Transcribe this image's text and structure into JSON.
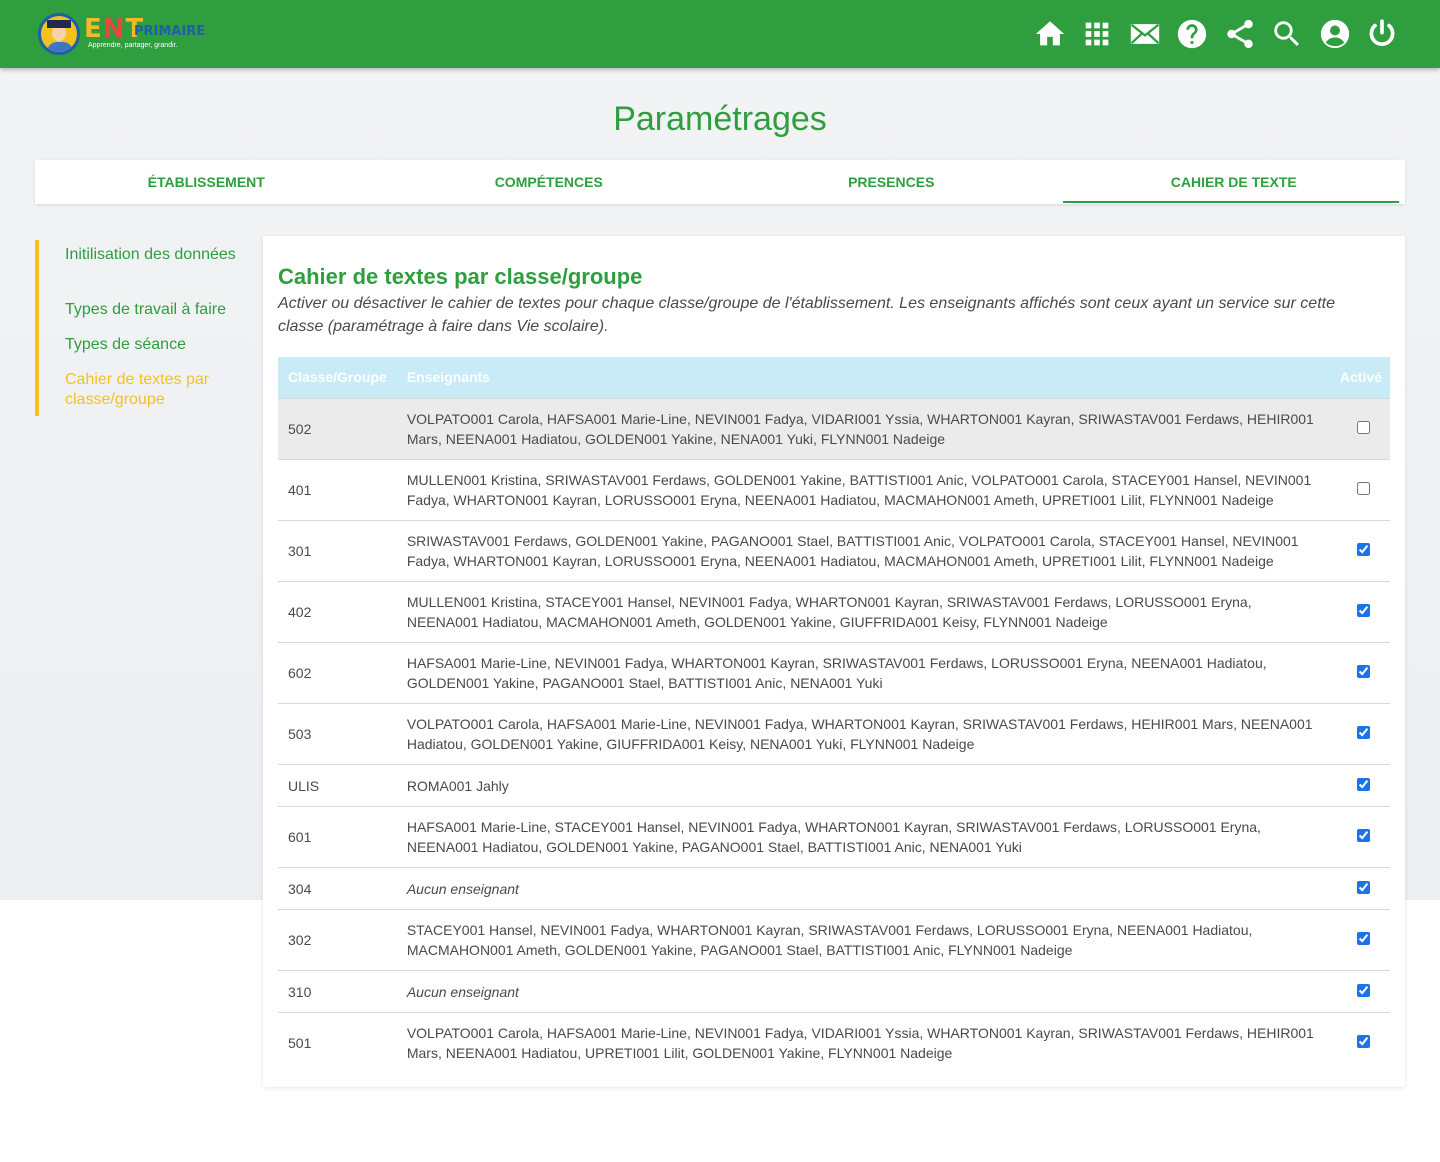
{
  "topbar": {
    "logo": {
      "ent": "ENT",
      "primaire": "PRIMAIRE",
      "tagline": "Apprendre, partager, grandir."
    },
    "icons": [
      "home-icon",
      "apps-grid-icon",
      "mail-icon",
      "help-icon",
      "share-icon",
      "search-icon",
      "account-icon",
      "power-icon"
    ],
    "color": "#2e9e3e"
  },
  "page": {
    "title": "Paramétrages"
  },
  "tabs": [
    {
      "label": "ÉTABLISSEMENT"
    },
    {
      "label": "COMPÉTENCES"
    },
    {
      "label": "PRESENCES"
    },
    {
      "label": "CAHIER DE TEXTE",
      "active": true
    }
  ],
  "sidenav": {
    "items": [
      {
        "label": "Initilisation des données"
      },
      {
        "label": "Types de travail à faire"
      },
      {
        "label": "Types de séance"
      },
      {
        "label": "Cahier de textes par classe/groupe",
        "active": true
      }
    ]
  },
  "card": {
    "title": "Cahier de textes par classe/groupe",
    "description": "Activer ou désactiver le cahier de textes pour chaque classe/groupe de l'établissement. Les enseignants affichés sont ceux ayant un service sur cette classe (paramétrage à faire dans Vie scolaire).",
    "table": {
      "headers": {
        "class": "Classe/Groupe",
        "teachers": "Enseignants",
        "active": "Activé"
      },
      "rows": [
        {
          "class": "502",
          "teachers": "VOLPATO001 Carola, HAFSA001 Marie-Line, NEVIN001 Fadya, VIDARI001 Yssia, WHARTON001 Kayran, SRIWASTAV001 Ferdaws, HEHIR001 Mars, NEENA001 Hadiatou, GOLDEN001 Yakine, NENA001 Yuki, FLYNN001 Nadeige",
          "active": false
        },
        {
          "class": "401",
          "teachers": "MULLEN001 Kristina, SRIWASTAV001 Ferdaws, GOLDEN001 Yakine, BATTISTI001 Anic, VOLPATO001 Carola, STACEY001 Hansel, NEVIN001 Fadya, WHARTON001 Kayran, LORUSSO001 Eryna, NEENA001 Hadiatou, MACMAHON001 Ameth, UPRETI001 Lilit, FLYNN001 Nadeige",
          "active": false
        },
        {
          "class": "301",
          "teachers": "SRIWASTAV001 Ferdaws, GOLDEN001 Yakine, PAGANO001 Stael, BATTISTI001 Anic, VOLPATO001 Carola, STACEY001 Hansel, NEVIN001 Fadya, WHARTON001 Kayran, LORUSSO001 Eryna, NEENA001 Hadiatou, MACMAHON001 Ameth, UPRETI001 Lilit, FLYNN001 Nadeige",
          "active": true
        },
        {
          "class": "402",
          "teachers": "MULLEN001 Kristina, STACEY001 Hansel, NEVIN001 Fadya, WHARTON001 Kayran, SRIWASTAV001 Ferdaws, LORUSSO001 Eryna, NEENA001 Hadiatou, MACMAHON001 Ameth, GOLDEN001 Yakine, GIUFFRIDA001 Keisy, FLYNN001 Nadeige",
          "active": true
        },
        {
          "class": "602",
          "teachers": "HAFSA001 Marie-Line, NEVIN001 Fadya, WHARTON001 Kayran, SRIWASTAV001 Ferdaws, LORUSSO001 Eryna, NEENA001 Hadiatou, GOLDEN001 Yakine, PAGANO001 Stael, BATTISTI001 Anic, NENA001 Yuki",
          "active": true
        },
        {
          "class": "503",
          "teachers": "VOLPATO001 Carola, HAFSA001 Marie-Line, NEVIN001 Fadya, WHARTON001 Kayran, SRIWASTAV001 Ferdaws, HEHIR001 Mars, NEENA001 Hadiatou, GOLDEN001 Yakine, GIUFFRIDA001 Keisy, NENA001 Yuki, FLYNN001 Nadeige",
          "active": true
        },
        {
          "class": "ULIS",
          "teachers": "ROMA001 Jahly",
          "active": true
        },
        {
          "class": "601",
          "teachers": "HAFSA001 Marie-Line, STACEY001 Hansel, NEVIN001 Fadya, WHARTON001 Kayran, SRIWASTAV001 Ferdaws, LORUSSO001 Eryna, NEENA001 Hadiatou, GOLDEN001 Yakine, PAGANO001 Stael, BATTISTI001 Anic, NENA001 Yuki",
          "active": true
        },
        {
          "class": "304",
          "teachers": "Aucun enseignant",
          "none": true,
          "active": true
        },
        {
          "class": "302",
          "teachers": "STACEY001 Hansel, NEVIN001 Fadya, WHARTON001 Kayran, SRIWASTAV001 Ferdaws, LORUSSO001 Eryna, NEENA001 Hadiatou, MACMAHON001 Ameth, GOLDEN001 Yakine, PAGANO001 Stael, BATTISTI001 Anic, FLYNN001 Nadeige",
          "active": true
        },
        {
          "class": "310",
          "teachers": "Aucun enseignant",
          "none": true,
          "active": true
        },
        {
          "class": "501",
          "teachers": "VOLPATO001 Carola, HAFSA001 Marie-Line, NEVIN001 Fadya, VIDARI001 Yssia, WHARTON001 Kayran, SRIWASTAV001 Ferdaws, HEHIR001 Mars, NEENA001 Hadiatou, UPRETI001 Lilit, GOLDEN001 Yakine, FLYNN001 Nadeige",
          "active": true
        }
      ]
    }
  }
}
